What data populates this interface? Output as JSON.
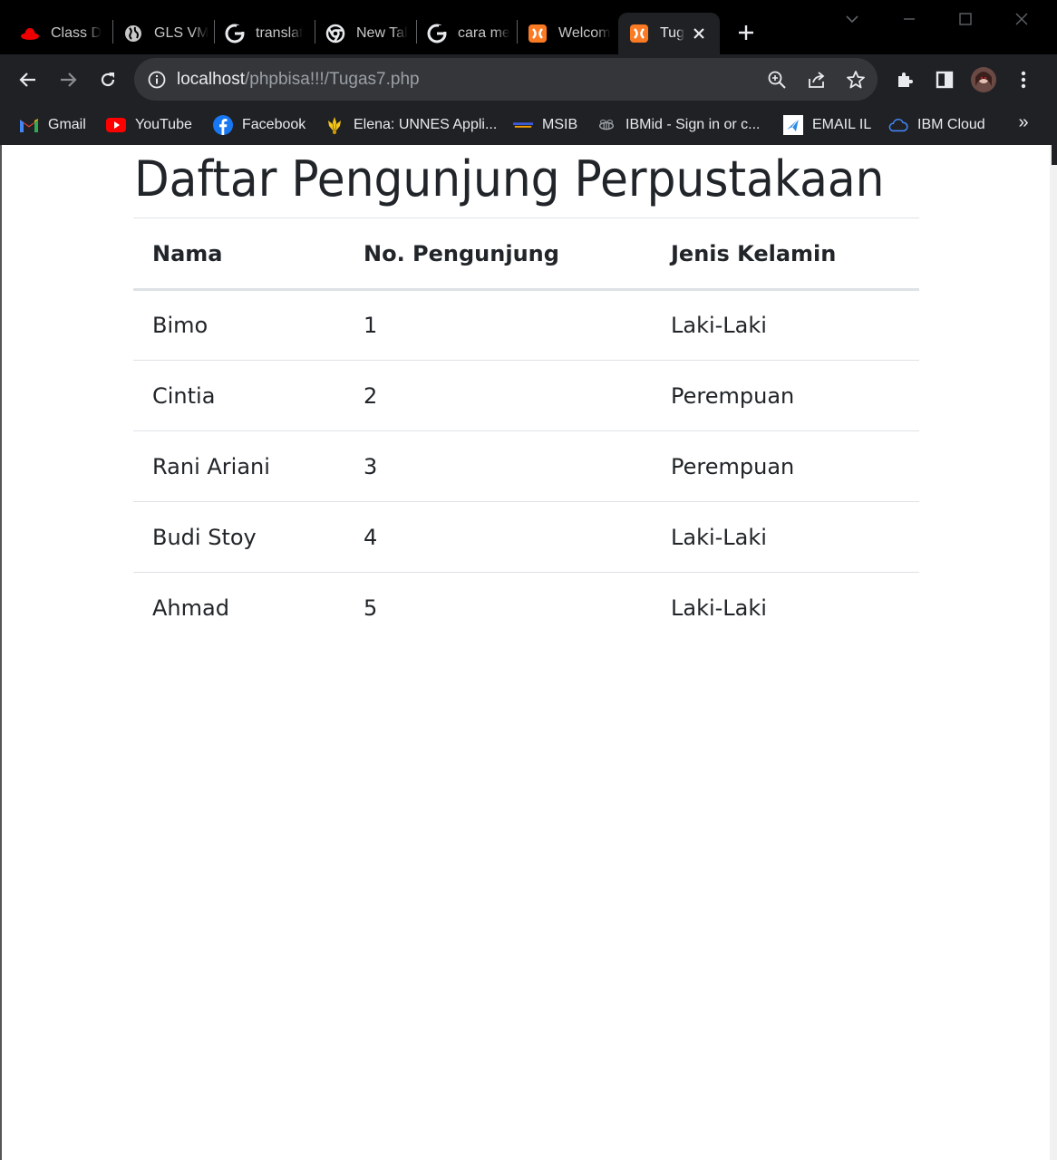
{
  "browser": {
    "tabs": [
      {
        "title": "Class D",
        "icon": "redhat-icon",
        "active": false
      },
      {
        "title": "GLS VM",
        "icon": "globe-icon",
        "active": false
      },
      {
        "title": "translat",
        "icon": "google-icon",
        "active": false
      },
      {
        "title": "New Tal",
        "icon": "chrome-icon",
        "active": false
      },
      {
        "title": "cara me",
        "icon": "google-icon",
        "active": false
      },
      {
        "title": "Welcom",
        "icon": "xampp-icon",
        "active": false
      },
      {
        "title": "Tug",
        "icon": "xampp-icon",
        "active": true
      }
    ],
    "address": {
      "host": "localhost",
      "path": "/phpbisa!!!/Tugas7.php"
    },
    "bookmarks": [
      {
        "label": "Gmail",
        "icon": "gmail-icon"
      },
      {
        "label": "YouTube",
        "icon": "youtube-icon"
      },
      {
        "label": "Facebook",
        "icon": "facebook-icon"
      },
      {
        "label": "Elena: UNNES Appli...",
        "icon": "unnes-icon"
      },
      {
        "label": "MSIB",
        "icon": "msib-icon"
      },
      {
        "label": "IBMid - Sign in or c...",
        "icon": "ibm-bee-icon"
      },
      {
        "label": "EMAIL IL",
        "icon": "email-icon"
      },
      {
        "label": "IBM Cloud",
        "icon": "cloud-icon"
      }
    ],
    "bookmarks_more": "»",
    "colors": {
      "frame": "#000000",
      "toolbar": "#202124",
      "omnibox": "#35363a"
    }
  },
  "page": {
    "title": "Daftar Pengunjung Perpustakaan",
    "table": {
      "headers": [
        "Nama",
        "No. Pengunjung",
        "Jenis Kelamin"
      ],
      "rows": [
        [
          "Bimo",
          "1",
          "Laki-Laki"
        ],
        [
          "Cintia",
          "2",
          "Perempuan"
        ],
        [
          "Rani Ariani",
          "3",
          "Perempuan"
        ],
        [
          "Budi Stoy",
          "4",
          "Laki-Laki"
        ],
        [
          "Ahmad",
          "5",
          "Laki-Laki"
        ]
      ]
    }
  }
}
